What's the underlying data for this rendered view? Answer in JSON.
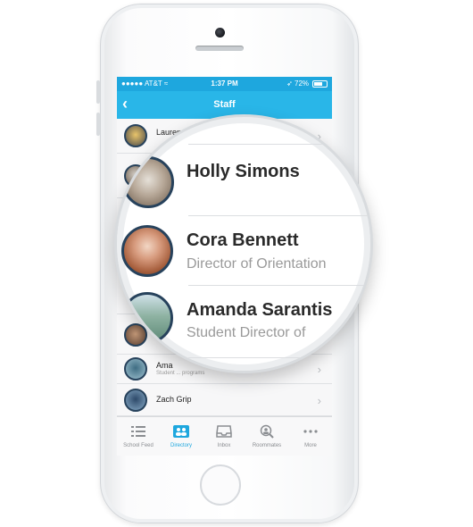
{
  "status_bar": {
    "carrier": "●●●●● AT&T ≈",
    "time": "1:37 PM",
    "battery": "➶ 72%",
    "battery_level": 0.72
  },
  "nav": {
    "back_icon": "chevron-left",
    "title": "Staff"
  },
  "list": [
    {
      "name": "Lauren",
      "subtitle": "",
      "avatar_colors": [
        "#e9c46a",
        "#4a4a4a"
      ]
    },
    {
      "name": "",
      "subtitle": "",
      "avatar_colors": [
        "#e5e0d8",
        "#6b5a4a"
      ]
    },
    {
      "name": "",
      "subtitle": "",
      "avatar_colors": [
        "#a65e3c",
        "#f2d6c4"
      ]
    },
    {
      "name": "",
      "subtitle": "",
      "avatar_colors": [
        "#5f8a78",
        "#cfe0e8"
      ]
    },
    {
      "name": "",
      "subtitle": "",
      "avatar_colors": [
        "#c79b7a",
        "#5a4032"
      ]
    },
    {
      "name": "Ama",
      "subtitle": "Student ... programs",
      "avatar_colors": [
        "#3f6d83",
        "#9ec1cf"
      ]
    },
    {
      "name": "Zach Grip",
      "subtitle": "",
      "avatar_colors": [
        "#2e4a6a",
        "#86a9c5"
      ]
    }
  ],
  "magnifier": {
    "rows": [
      {
        "name": "Holly Simons",
        "subtitle": ""
      },
      {
        "name": "Cora Bennett",
        "subtitle": "Director of Orientation"
      },
      {
        "name": "Amanda Sarantis",
        "subtitle": "Student Director of"
      }
    ]
  },
  "tabs": [
    {
      "label": "School Feed",
      "icon": "list-icon",
      "active": false
    },
    {
      "label": "Directory",
      "icon": "people-icon",
      "active": true
    },
    {
      "label": "Inbox",
      "icon": "inbox-icon",
      "active": false
    },
    {
      "label": "Roommates",
      "icon": "search-people-icon",
      "active": false
    },
    {
      "label": "More",
      "icon": "more-icon",
      "active": false
    }
  ],
  "colors": {
    "accent": "#29b6e8",
    "status_bar": "#1ea7de",
    "avatar_ring": "#27425c"
  }
}
